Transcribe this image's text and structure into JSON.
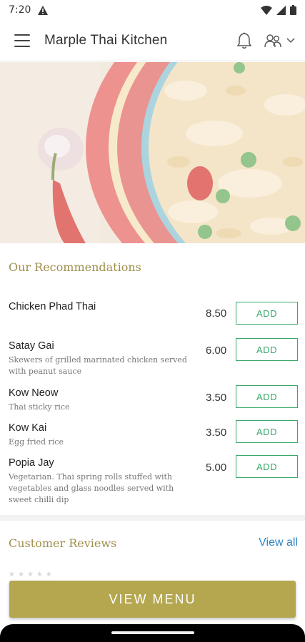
{
  "status_bar": {
    "time": "7:20"
  },
  "header": {
    "title": "Marple Thai Kitchen"
  },
  "recommendations": {
    "title": "Our Recommendations",
    "items": [
      {
        "name": "Chicken Phad Thai",
        "description": "",
        "price": "8.50",
        "add_label": "ADD"
      },
      {
        "name": "Satay Gai",
        "description": "Skewers of grilled marinated chicken served with peanut sauce",
        "price": "6.00",
        "add_label": "ADD"
      },
      {
        "name": "Kow Neow",
        "description": "Thai sticky rice",
        "price": "3.50",
        "add_label": "ADD"
      },
      {
        "name": "Kow Kai",
        "description": "Egg fried rice",
        "price": "3.50",
        "add_label": "ADD"
      },
      {
        "name": "Popia Jay",
        "description": "Vegetarian. Thai spring rolls stuffed with vegetables and glass noodles served with sweet chilli dip",
        "price": "5.00",
        "add_label": "ADD"
      }
    ]
  },
  "reviews": {
    "title": "Customer Reviews",
    "view_all": "View all"
  },
  "footer": {
    "view_menu_label": "VIEW MENU"
  },
  "colors": {
    "accent_gold": "#b5a650",
    "section_title": "#a08f4d",
    "add_green": "#3aa86b",
    "link_blue": "#2f86c4"
  },
  "icons": [
    "menu-icon",
    "bell-icon",
    "account-icon",
    "chevron-down-icon",
    "alert-icon",
    "wifi-icon",
    "signal-icon",
    "battery-icon"
  ]
}
